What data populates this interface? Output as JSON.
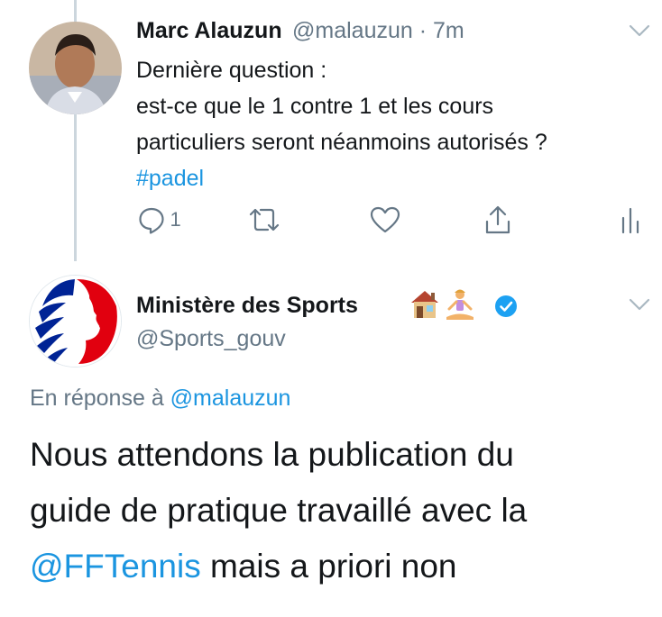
{
  "tweet1": {
    "name": "Marc Alauzun",
    "handle": "@malauzun",
    "separator": "·",
    "time": "7m",
    "lines": [
      "Dernière question :",
      "est-ce que le 1 contre 1 et les cours",
      "particuliers seront néanmoins autorisés ?"
    ],
    "hashtag": "#padel",
    "reply_count": "1",
    "icons": [
      "avatar",
      "chevron-down-icon",
      "reply-icon",
      "retweet-icon",
      "like-icon",
      "share-icon",
      "analytics-icon"
    ]
  },
  "tweet2": {
    "name": "Ministère des Sports",
    "emojis": "🏠🧘",
    "handle": "@Sports_gouv",
    "reply_prefix": "En réponse à",
    "reply_handle": "@malauzun",
    "lines": [
      "Nous attendons la publication du",
      "guide de pratique travaillé avec la"
    ],
    "mention": "@FFTennis",
    "tail": " mais a priori non",
    "icons": [
      "marianne-logo",
      "house-emoji",
      "yoga-emoji",
      "verified-badge-icon",
      "chevron-down-icon"
    ]
  },
  "colors": {
    "link": "#1b95e0",
    "muted": "#657786",
    "text": "#14171a",
    "verified": "#1da1f2",
    "thread_line": "#ccd6dd"
  }
}
